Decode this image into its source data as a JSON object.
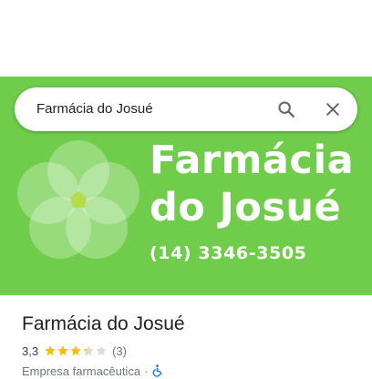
{
  "search": {
    "query": "Farmácia do Josué"
  },
  "hero": {
    "brand_line1": "Farmácia",
    "brand_line2": "do Josué",
    "phone": "(14) 3346-3505",
    "background_color": "#6fcd4b"
  },
  "place": {
    "title": "Farmácia do Josué",
    "rating": "3,3",
    "rating_value": 3.3,
    "rating_max": 5,
    "review_count": "(3)",
    "category": "Empresa farmacêutica",
    "separator": "·",
    "accessibility_icon": "wheelchair-icon"
  },
  "colors": {
    "star": "#fbbc04",
    "star_empty": "#dadce0",
    "accessibility": "#1a73e8"
  }
}
